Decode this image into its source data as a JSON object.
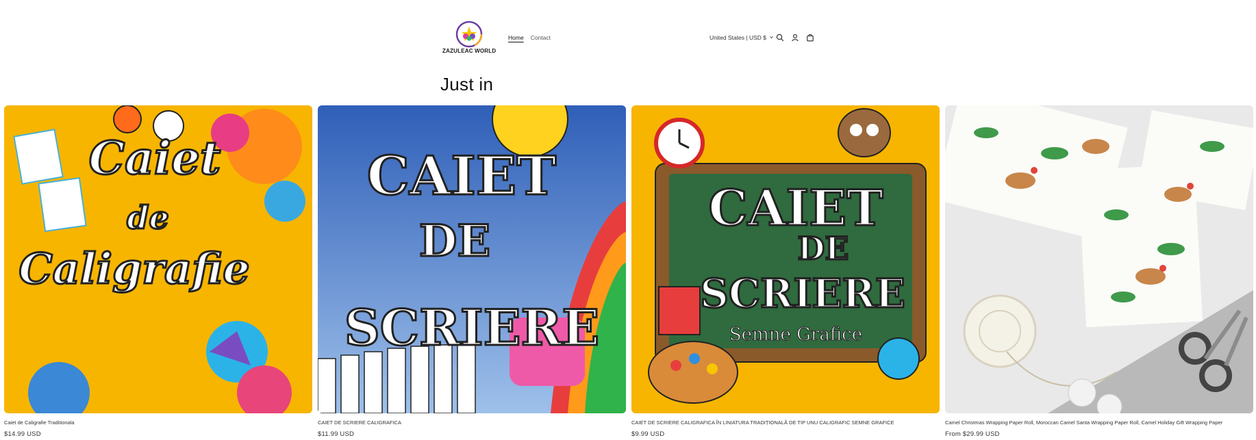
{
  "brand": {
    "name": "ZAZULEAC WORLD"
  },
  "nav": {
    "items": [
      {
        "label": "Home"
      },
      {
        "label": "Contact"
      }
    ]
  },
  "locale": {
    "label": "United States | USD $"
  },
  "header_icons": [
    "search-icon",
    "account-icon",
    "cart-icon"
  ],
  "section": {
    "title": "Just in"
  },
  "products": [
    {
      "title": "Caiet de Caligrafie Traditionala",
      "price": "$14.99 USD",
      "image_text": [
        "Caiet",
        "de",
        "Caligrafie"
      ]
    },
    {
      "title": "CAIET DE SCRIERE CALIGRAFICA",
      "price": "$11.99 USD",
      "image_text": [
        "CAIET",
        "DE",
        "SCRIERE"
      ]
    },
    {
      "title": "CAIET DE SCRIERE CALIGRAFICA ÎN LINIATURA TRADIȚIONALĂ DE TIP UNU CALIGRAFIC SEMNE GRAFICE",
      "price": "$9.99 USD",
      "image_text": [
        "CAIET",
        "DE",
        "SCRIERE",
        "Semne Grafice"
      ]
    },
    {
      "title": "Camel Christmas Wrapping Paper Roll, Moroccan Camel Santa Wrapping Paper Roll, Camel Holiday Gift Wrapping Paper",
      "price": "From $29.99 USD",
      "image_text": []
    }
  ],
  "colors": {
    "accent_yellow": "#f7b500",
    "board_green": "#2f6b3e",
    "sky_blue": "#3d6fc4"
  }
}
